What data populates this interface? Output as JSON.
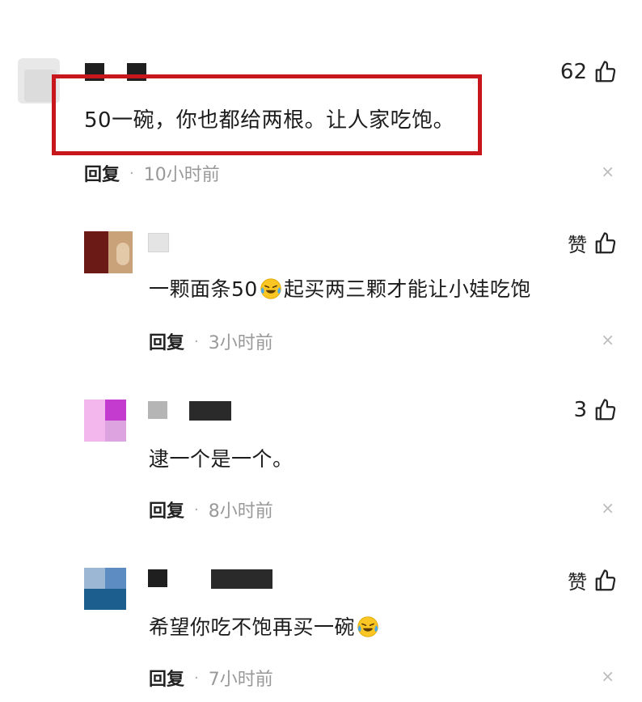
{
  "comments": [
    {
      "text": "50一碗，你也都给两根。让人家吃饱。",
      "likes": "62",
      "reply_label": "回复",
      "time": "10小时前",
      "close_glyph": "×"
    },
    {
      "text_before_emoji": "一颗面条50",
      "text_after_emoji": "起买两三颗才能让小娃吃饱",
      "likes": "赞",
      "reply_label": "回复",
      "time": "3小时前",
      "close_glyph": "×"
    },
    {
      "text": "逮一个是一个。",
      "likes": "3",
      "reply_label": "回复",
      "time": "8小时前",
      "close_glyph": "×"
    },
    {
      "text": "希望你吃不饱再买一碗",
      "likes": "赞",
      "reply_label": "回复",
      "time": "7小时前",
      "close_glyph": "×"
    }
  ],
  "meta_separator": "·",
  "colors": {
    "highlight_border": "#c8161d",
    "time_text": "#999999"
  },
  "icons": {
    "like": "thumbs-up-icon",
    "emoji": "crying-laughing-emoji-icon",
    "close": "close-icon"
  }
}
